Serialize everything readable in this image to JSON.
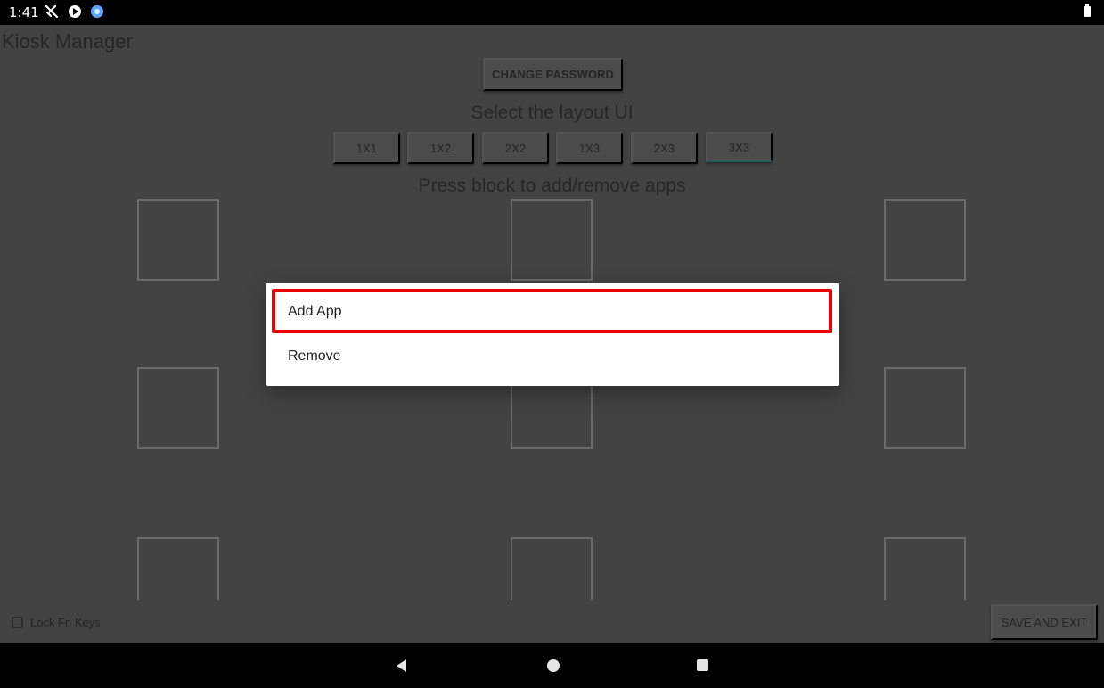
{
  "status_bar": {
    "time": "1:41",
    "icons": [
      "tools-icon",
      "vpn-key-icon",
      "app-icon",
      "battery-icon"
    ]
  },
  "app": {
    "title": "Kiosk Manager"
  },
  "actions": {
    "change_password": "CHANGE PASSWORD",
    "save_and_exit": "SAVE AND EXIT"
  },
  "layout": {
    "heading": "Select the layout UI",
    "options": [
      "1X1",
      "1X2",
      "2X2",
      "1X3",
      "2X3",
      "3X3"
    ],
    "selected": "3X3"
  },
  "blocks": {
    "heading": "Press block to add/remove apps"
  },
  "lock_fn_keys": {
    "label": "Lock Fn Keys",
    "checked": false
  },
  "dialog": {
    "items": [
      "Add App",
      "Remove"
    ],
    "highlighted": "Add App",
    "highlight_color": "#ef0000"
  },
  "navigation": {
    "buttons": [
      "back-icon",
      "home-icon",
      "recent-apps-icon"
    ]
  }
}
